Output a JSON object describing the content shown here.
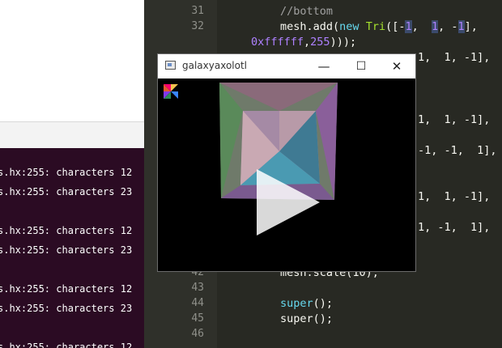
{
  "editor": {
    "lines": [
      {
        "n": "31",
        "code": "//bottom"
      },
      {
        "n": "32",
        "code": "mesh.add(new Tri([-1,  1, -1],"
      },
      {
        "n": "",
        "code": "0xffffff,255)));"
      },
      {
        "n": "42",
        "code": "mesh.scale(10);"
      },
      {
        "n": "43",
        "code": ""
      },
      {
        "n": "44",
        "code": "super();"
      },
      {
        "n": "45",
        "code": "}"
      },
      {
        "n": "46",
        "code": ""
      }
    ],
    "partial_rows": [
      "1,  1, -1],",
      "1,  1, -1],",
      "-1, -1,  1],",
      "1,  1, -1],",
      "1, -1,  1],"
    ]
  },
  "terminal": {
    "lines": [
      "s.hx:255: characters 12",
      "s.hx:255: characters 23",
      "s.hx:255: characters 12",
      "s.hx:255: characters 23",
      "s.hx:255: characters 12",
      "s.hx:255: characters 23",
      "s.hx:255: characters 12"
    ]
  },
  "window": {
    "title": "galaxyaxolotl",
    "minimize": "—",
    "maximize": "☐",
    "close": "✕"
  },
  "colors": {
    "editor_bg": "#282923",
    "terminal_bg": "#2b0b23",
    "comment": "#a1a1a1",
    "keyword": "#66d9ef",
    "function": "#a6e22e",
    "number": "#ae81ff"
  },
  "icons": [
    "app-window-icon",
    "logo-icon",
    "play-icon"
  ]
}
